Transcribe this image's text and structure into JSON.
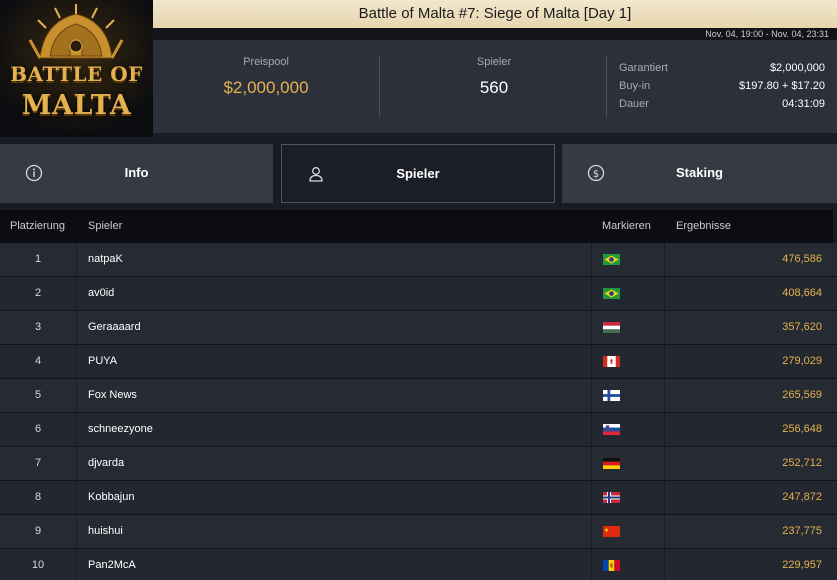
{
  "logo": {
    "line1": "BATTLE OF",
    "line2": "MALTA"
  },
  "header": {
    "title": "Battle of Malta #7: Siege of Malta [Day 1]",
    "dates": "Nov. 04, 19:00 - Nov. 04, 23:31"
  },
  "stats": {
    "prize_pool_label": "Preispool",
    "prize_pool_value": "$2,000,000",
    "players_label": "Spieler",
    "players_value": "560",
    "details": [
      {
        "key": "Garantiert",
        "value": "$2,000,000"
      },
      {
        "key": "Buy-in",
        "value": "$197.80 + $17.20"
      },
      {
        "key": "Dauer",
        "value": "04:31:09"
      }
    ]
  },
  "tabs": [
    {
      "label": "Info",
      "icon": "info-circle-icon",
      "active": false
    },
    {
      "label": "Spieler",
      "icon": "user-icon",
      "active": true
    },
    {
      "label": "Staking",
      "icon": "dollar-circle-icon",
      "active": false
    }
  ],
  "table": {
    "headers": {
      "rank": "Platzierung",
      "player": "Spieler",
      "flag": "Markieren",
      "result": "Ergebnisse"
    },
    "rows": [
      {
        "rank": "1",
        "player": "natpaK",
        "flag": "brazil",
        "result": "476,586"
      },
      {
        "rank": "2",
        "player": "av0id",
        "flag": "brazil",
        "result": "408,664"
      },
      {
        "rank": "3",
        "player": "Geraaaard",
        "flag": "hungary",
        "result": "357,620"
      },
      {
        "rank": "4",
        "player": "PUYA",
        "flag": "canada",
        "result": "279,029"
      },
      {
        "rank": "5",
        "player": "Fox News",
        "flag": "finland",
        "result": "265,569"
      },
      {
        "rank": "6",
        "player": "schneezyone",
        "flag": "slovenia",
        "result": "256,648"
      },
      {
        "rank": "7",
        "player": "djvarda",
        "flag": "germany",
        "result": "252,712"
      },
      {
        "rank": "8",
        "player": "Kobbajun",
        "flag": "norway",
        "result": "247,872"
      },
      {
        "rank": "9",
        "player": "huishui",
        "flag": "china",
        "result": "237,775"
      },
      {
        "rank": "10",
        "player": "Pan2McA",
        "flag": "moldova",
        "result": "229,957"
      }
    ]
  },
  "colors": {
    "gold": "#e3b24e",
    "background": "#191c24",
    "panel": "#2c303a"
  }
}
